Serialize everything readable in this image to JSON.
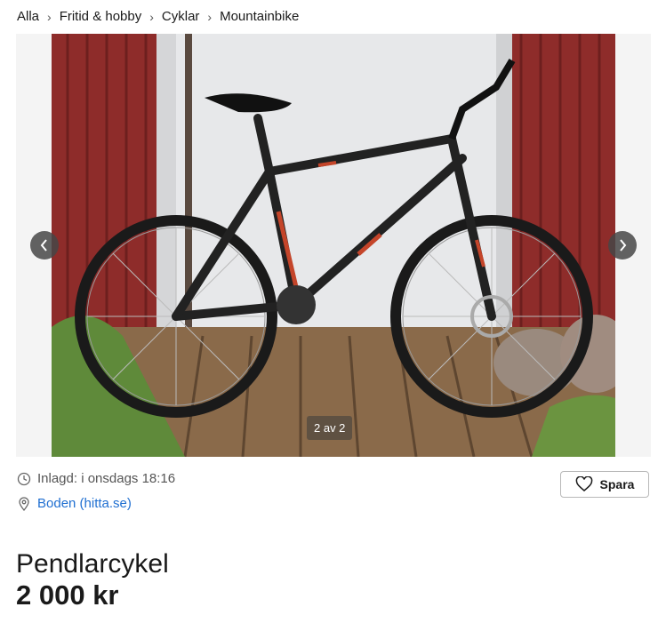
{
  "breadcrumb": {
    "items": [
      "Alla",
      "Fritid & hobby",
      "Cyklar",
      "Mountainbike"
    ],
    "separator": "›"
  },
  "gallery": {
    "counter": "2 av 2",
    "prev_icon": "chevron-left-icon",
    "next_icon": "chevron-right-icon"
  },
  "listing": {
    "posted": "Inlagd: i onsdags 18:16",
    "location": "Boden (hitta.se)",
    "title": "Pendlarcykel",
    "price": "2 000 kr"
  },
  "actions": {
    "save_label": "Spara",
    "save_icon": "heart-icon"
  },
  "colors": {
    "link": "#1f6fd1",
    "wall_red": "#8e2c2a",
    "door_white": "#e7e8ea",
    "deck": "#8a6a4a"
  }
}
